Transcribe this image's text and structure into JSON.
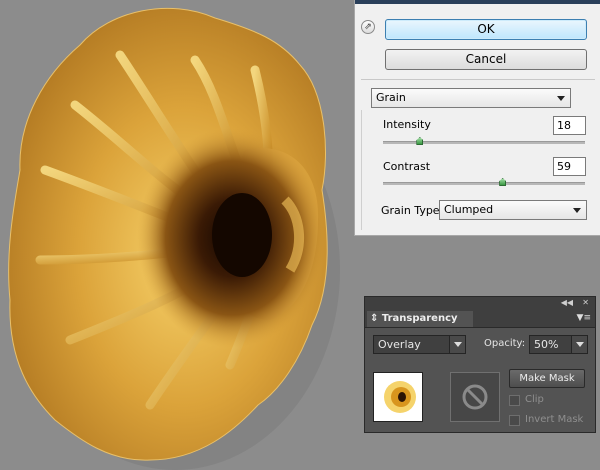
{
  "artwork": {
    "subject": "flower-shape",
    "colors": {
      "gold_light": "#f2c65c",
      "gold_mid": "#d69a2a",
      "gold_dark": "#7b4a10",
      "center": "#1a0b02"
    }
  },
  "grain_dialog": {
    "ok_label": "OK",
    "cancel_label": "Cancel",
    "type_value": "Grain",
    "intensity_label": "Intensity",
    "intensity_value": "18",
    "intensity_level": 18,
    "contrast_label": "Contrast",
    "contrast_value": "59",
    "contrast_level": 59,
    "grain_type_label": "Grain Type:",
    "grain_type_value": "Clumped"
  },
  "transparency_panel": {
    "tab_title": "Transparency",
    "blend_mode": "Overlay",
    "opacity_label": "Opacity:",
    "opacity_value": "50%",
    "make_mask_label": "Make Mask",
    "clip_label": "Clip",
    "invert_mask_label": "Invert Mask",
    "icons": {
      "collapse": "double-arrow-icon",
      "close": "close-icon",
      "menu": "panel-menu-icon",
      "no_mask": "no-symbol-icon"
    }
  },
  "colors": {
    "ok_border": "#3c7fb1",
    "panel_bg": "#535353",
    "canvas_bg": "#8c8c8c"
  }
}
